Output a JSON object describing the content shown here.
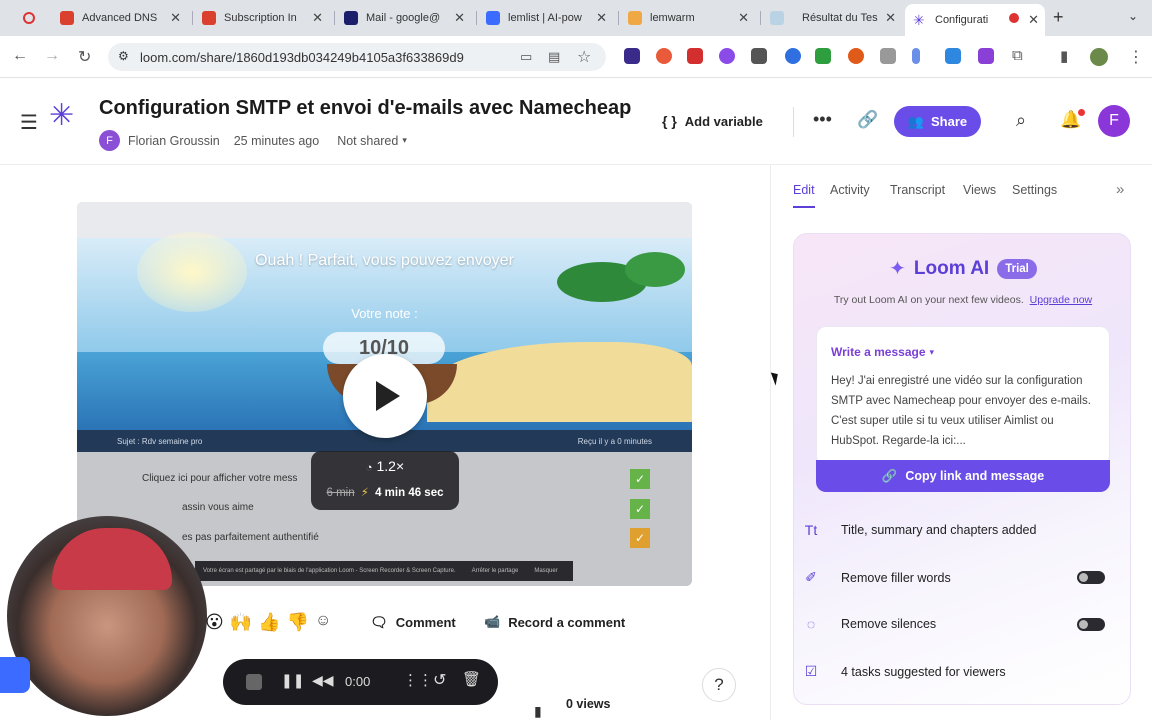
{
  "browser": {
    "tabs": [
      {
        "label": "Advanced DNS",
        "color": "#d9402e"
      },
      {
        "label": "Subscription In",
        "color": "#d9402e"
      },
      {
        "label": "Mail - google@",
        "color": "#1b1f6b"
      },
      {
        "label": "lemlist | AI-pow",
        "color": "#3b6bff"
      },
      {
        "label": "lemwarm",
        "color": "#f0a845"
      },
      {
        "label": "Résultat du Tes",
        "color": "#b9d3e4"
      },
      {
        "label": "Configurati",
        "color": "#5b3fd6"
      }
    ],
    "url": "loom.com/share/1860d193db034249b4105a3f633869d9"
  },
  "header": {
    "title": "Configuration SMTP et envoi d'e-mails avec Namecheap",
    "author_initial": "F",
    "author": "Florian Groussin",
    "time": "25 minutes ago",
    "share_status": "Not shared",
    "add_variable": "Add variable",
    "share": "Share",
    "user_initial": "F"
  },
  "video": {
    "headline": "Ouah ! Parfait, vous pouvez envoyer",
    "note_label": "Votre note :",
    "score": "10/10",
    "subject": "Sujet : Rdv semaine pro",
    "received": "Reçu il y a 0 minutes",
    "rows": [
      "Cliquez ici pour afficher votre mess",
      "assin vous aime",
      "es pas parfaitement authentifié"
    ],
    "speed": "1.2×",
    "old_duration": "6 min",
    "new_duration": "4 min 46 sec",
    "share_banner": "Votre écran est partagé par le biais de l'application Loom - Screen Recorder & Screen Capture.",
    "stop_share": "Arrêter le partage",
    "hide": "Masquer"
  },
  "actions": {
    "comment": "Comment",
    "record_comment": "Record a comment",
    "time": "0:00",
    "views": "0 views"
  },
  "panel": {
    "tabs": [
      "Edit",
      "Activity",
      "Transcript",
      "Views",
      "Settings"
    ],
    "ai_title": "Loom AI",
    "trial": "Trial",
    "try_text": "Try out Loom AI on your next few videos.",
    "upgrade": "Upgrade now",
    "write_message": "Write a message",
    "message": "Hey! J'ai enregistré une vidéo sur la configuration SMTP avec Namecheap pour envoyer des e-mails. C'est super utile si tu veux utiliser Aimlist ou HubSpot. Regarde-la ici:...",
    "copy": "Copy link and message",
    "features": [
      {
        "label": "Title, summary and chapters added",
        "icon": "text-icon"
      },
      {
        "label": "Remove filler words",
        "icon": "sparkle-icon"
      },
      {
        "label": "Remove silences",
        "icon": "silence-icon"
      },
      {
        "label": "4 tasks suggested for viewers",
        "icon": "checklist-icon"
      }
    ]
  },
  "colors": {
    "accent": "#6a4ce8",
    "brand": "#5b3fd6"
  }
}
